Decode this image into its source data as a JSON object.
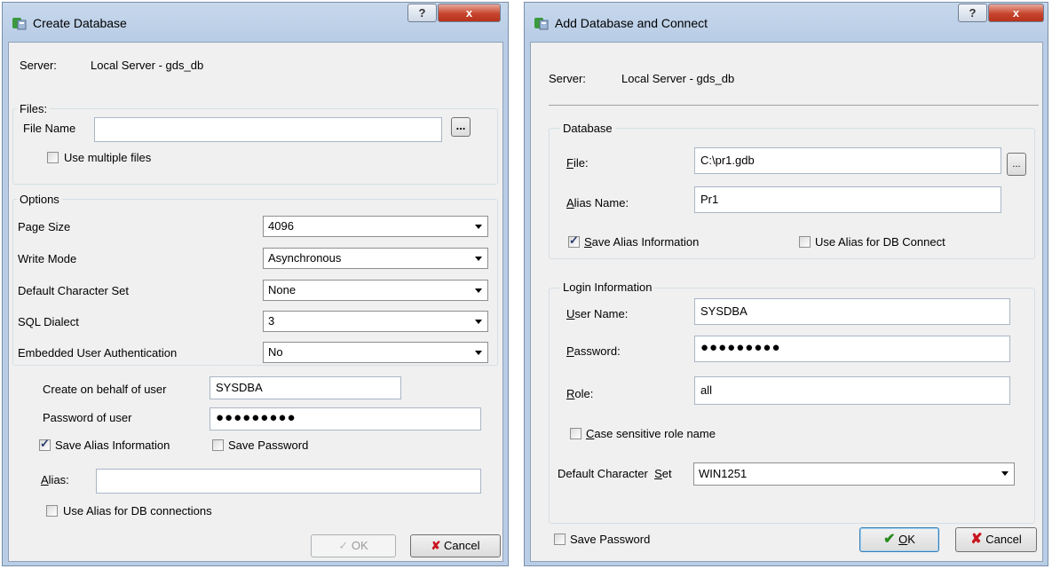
{
  "left": {
    "title": "Create Database",
    "server_label": "Server:",
    "server_value": "Local Server - gds_db",
    "files_group": "Files:",
    "file_name_label": "File Name",
    "file_name_value": "",
    "browse_label": "...",
    "multiple_files_label": "Use multiple files",
    "options_group": "Options",
    "page_size_label": "Page Size",
    "page_size_value": "4096",
    "write_mode_label": "Write Mode",
    "write_mode_value": "Asynchronous",
    "charset_label": "Default Character Set",
    "charset_value": "None",
    "dialect_label": "SQL Dialect",
    "dialect_value": "3",
    "embedded_auth_label": "Embedded User Authentication",
    "embedded_auth_value": "No",
    "behalf_label": "Create on behalf of user",
    "behalf_value": "SYSDBA",
    "password_label": "Password of user",
    "password_value": "●●●●●●●●●",
    "save_alias_label": "Save Alias Information",
    "save_password_label": "Save Password",
    "alias_label": "Alias:",
    "alias_value": "",
    "use_alias_label": "Use Alias for DB connections",
    "ok_label": "OK",
    "cancel_label": "Cancel"
  },
  "right": {
    "title": "Add Database and Connect",
    "server_label": "Server:",
    "server_value": "Local Server - gds_db",
    "database_group": "Database",
    "file_label": "File:",
    "file_value": "C:\\pr1.gdb",
    "browse_label": "...",
    "alias_name_label": "Alias Name:",
    "alias_name_value": "Pr1",
    "save_alias_label": "Save Alias Information",
    "use_alias_label": "Use Alias for DB Connect",
    "login_group": "Login Information",
    "user_name_label": "User Name:",
    "user_name_value": "SYSDBA",
    "password_label": "Password:",
    "password_value": "●●●●●●●●●",
    "role_label": "Role:",
    "role_value": "all",
    "case_sensitive_label": "Case sensitive role name",
    "charset_label": "Default Character  Set",
    "charset_value": "WIN1251",
    "save_password_label": "Save Password",
    "ok_label": "OK",
    "cancel_label": "Cancel"
  },
  "caption_buttons": {
    "help": "?",
    "close": "x"
  }
}
